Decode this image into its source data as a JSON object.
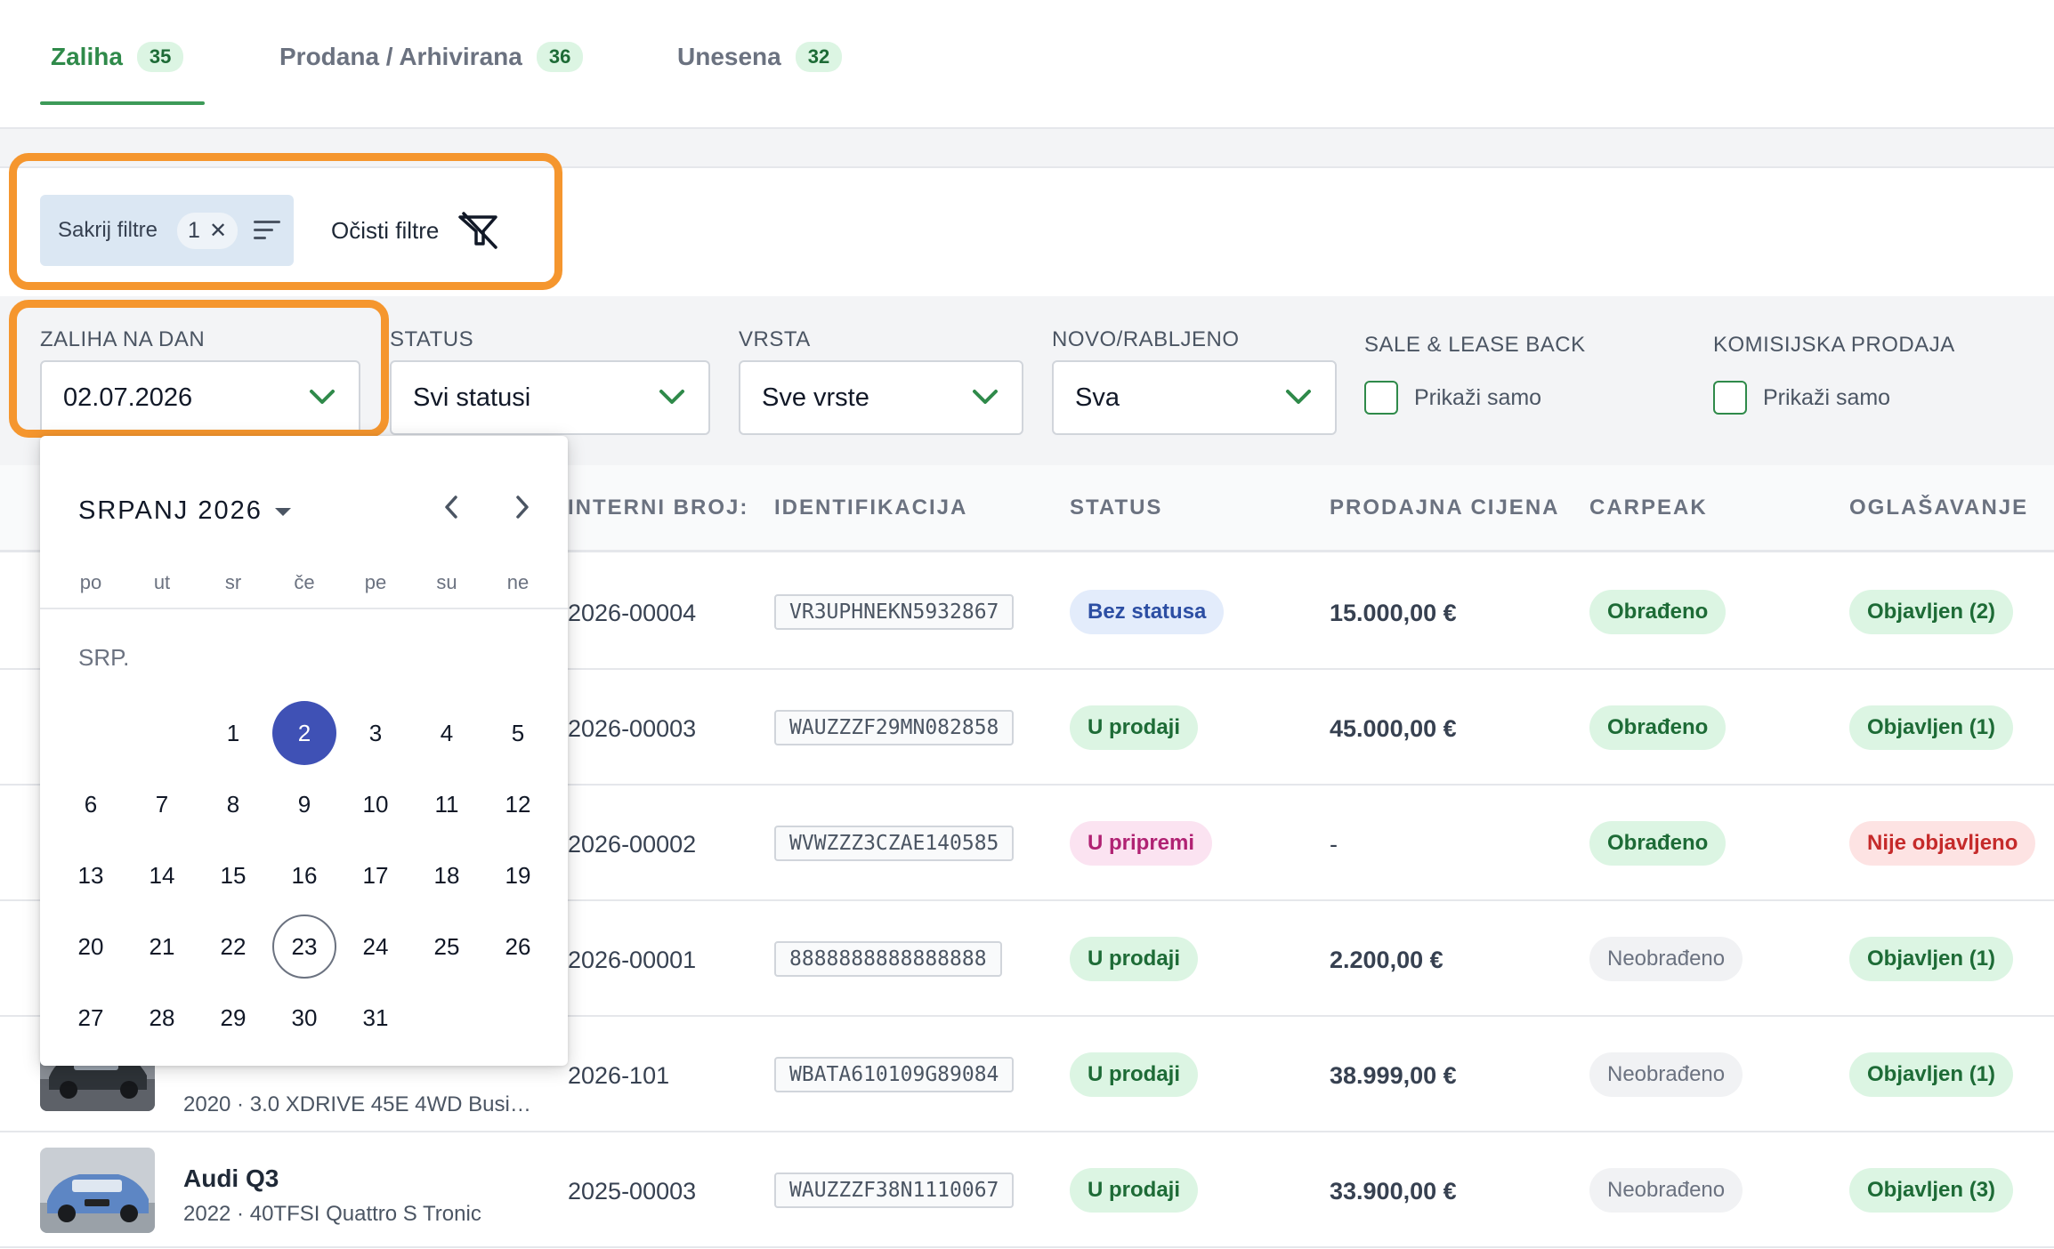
{
  "tabs": [
    {
      "label": "Zaliha",
      "count": "35"
    },
    {
      "label": "Prodana / Arhivirana",
      "count": "36"
    },
    {
      "label": "Unesena",
      "count": "32"
    }
  ],
  "filter_bar": {
    "hide_filters_label": "Sakrij filtre",
    "active_count": "1",
    "clear_filters_label": "Očisti filtre"
  },
  "filters": {
    "stock_date": {
      "label": "ZALIHA NA DAN",
      "value": "02.07.2026"
    },
    "status": {
      "label": "STATUS",
      "value": "Svi statusi"
    },
    "type": {
      "label": "VRSTA",
      "value": "Sve vrste"
    },
    "condition": {
      "label": "NOVO/RABLJENO",
      "value": "Sva"
    },
    "sale_lease_back": {
      "label": "SALE & LEASE BACK",
      "checkbox_label": "Prikaži samo"
    },
    "commission_sale": {
      "label": "KOMISIJSKA PRODAJA",
      "checkbox_label": "Prikaži samo"
    }
  },
  "table": {
    "columns": [
      "INTERNI BROJ:",
      "IDENTIFIKACIJA",
      "STATUS",
      "PRODAJNA CIJENA",
      "CARPEAK",
      "OGLAŠAVANJE"
    ],
    "rows": [
      {
        "internal": "2026-00004",
        "vin": "VR3UPHNEKN5932867",
        "status": "Bez statusa",
        "price": "15.000,00 €",
        "carpeak": "Obrađeno",
        "ads": "Objavljen (2)"
      },
      {
        "internal": "2026-00003",
        "vin": "WAUZZZF29MN082858",
        "status": "U prodaji",
        "price": "45.000,00 €",
        "carpeak": "Obrađeno",
        "ads": "Objavljen (1)"
      },
      {
        "internal": "2026-00002",
        "vin": "WVWZZZ3CZAE140585",
        "status": "U pripremi",
        "price": "-",
        "carpeak": "Obrađeno",
        "ads": "Nije objavljeno"
      },
      {
        "internal": "2026-00001",
        "vin": "8888888888888888",
        "status": "U prodaji",
        "price": "2.200,00 €",
        "carpeak": "Neobrađeno",
        "ads": "Objavljen (1)"
      },
      {
        "internal": "2026-101",
        "vin": "WBATA610109G89084",
        "status": "U prodaji",
        "price": "38.999,00 €",
        "carpeak": "Neobrađeno",
        "ads": "Objavljen (1)",
        "subtitle": "2020 · 3.0 XDRIVE 45E 4WD Busi…"
      },
      {
        "internal": "2025-00003",
        "vin": "WAUZZZF38N1110067",
        "status": "U prodaji",
        "price": "33.900,00 €",
        "carpeak": "Neobrađeno",
        "ads": "Objavljen (3)",
        "title": "Audi Q3",
        "subtitle": "2022 · 40TFSI Quattro S Tronic"
      }
    ]
  },
  "calendar": {
    "month_label": "SRPANJ 2026",
    "section_label": "SRP.",
    "weekdays": [
      "po",
      "ut",
      "sr",
      "če",
      "pe",
      "su",
      "ne"
    ],
    "selected_day": "2",
    "today_day": "23"
  },
  "colors": {
    "accent": "#2f8a4a",
    "highlight": "#f5962e",
    "selected_day": "#3f51b5"
  }
}
